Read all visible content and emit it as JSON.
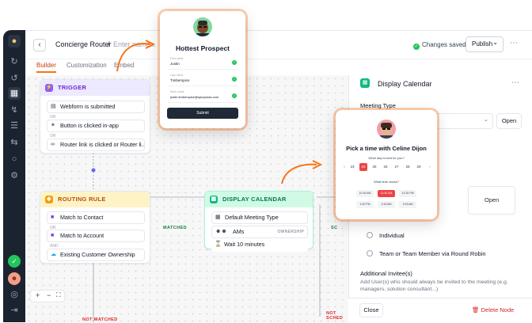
{
  "rail": {
    "icons": [
      "logo-icon",
      "refresh-icon",
      "refresh-alt-icon",
      "router-icon",
      "flow-icon",
      "stack-icon",
      "swap-icon",
      "chat-icon",
      "settings-icon",
      "sdk-icon",
      "status-icon",
      "user-avatar-icon",
      "help-icon",
      "logout-icon"
    ]
  },
  "topbar": {
    "title": "Concierge Router",
    "separator": "/",
    "subtitle": "Enter name...",
    "saved": "Changes saved",
    "publish": "Publish",
    "publish_chevron": "⌄",
    "more": "⋯"
  },
  "tabs": [
    "Builder",
    "Customization",
    "Embed"
  ],
  "trigger": {
    "label": "TRIGGER",
    "rows": [
      "Webform is submitted",
      "Button is clicked in-app",
      "Router link is clicked or Router li..."
    ],
    "separators": [
      "OR",
      "OR"
    ]
  },
  "routing_rule": {
    "label": "ROUTING RULE",
    "rows": [
      "Match to Contact",
      "Match to Account",
      "Existing Customer Ownership"
    ],
    "separators": [
      "OR",
      "AND"
    ]
  },
  "display_calendar_node": {
    "label": "DISPLAY CALENDAR",
    "rows": [
      "Default Meeting Type",
      "AMs",
      "Wait 10 minutes"
    ],
    "badge": "OWNERSHIP"
  },
  "edges": {
    "matched": "MATCHED",
    "not_matched": "NOT MATCHED",
    "sc": "SC",
    "not_sched": "NOT SCHED"
  },
  "zoom": {
    "plus": "+",
    "minus": "−",
    "fit": "⛶"
  },
  "panel": {
    "title": "Display Calendar",
    "more": "⋯",
    "meeting_type": "Meeting Type",
    "open": "Open",
    "chevron": "⌄",
    "radios": [
      "Individual",
      "Team or Team Member via Round Robin"
    ],
    "additional": "Additional Invitee(s)",
    "additional_desc": "Add User(s) who should always be invited to the meeting (e.g. managers, solution consultant...)",
    "close": "Close",
    "delete": "Delete Node"
  },
  "prospect_popup": {
    "title": "Hottest Prospect",
    "fields": [
      {
        "label": "First name",
        "value": "Justin"
      },
      {
        "label": "Last name",
        "value": "Timberspice"
      },
      {
        "label": "Work email",
        "value": "justin.timberspice@spicyseas.com"
      }
    ],
    "submit": "Submit"
  },
  "calendar_popup": {
    "title": "Pick a time with Celine Dijon",
    "day_question": "What day is best for you?",
    "days": [
      "23",
      "24",
      "25",
      "26",
      "27",
      "28",
      "29"
    ],
    "selected_day": "24",
    "time_question": "What time works?",
    "slots": [
      "10:15 AM",
      "11:00 AM",
      "12:15 PM",
      "1:00 PM",
      "2:15 AM",
      "3:15 AM"
    ],
    "selected_slot": "11:00 AM"
  },
  "colors": {
    "accent": "#f97316",
    "trigger": "#8b5cf6",
    "routing": "#f59e0b",
    "calendar": "#10b981",
    "danger": "#dc2626"
  }
}
